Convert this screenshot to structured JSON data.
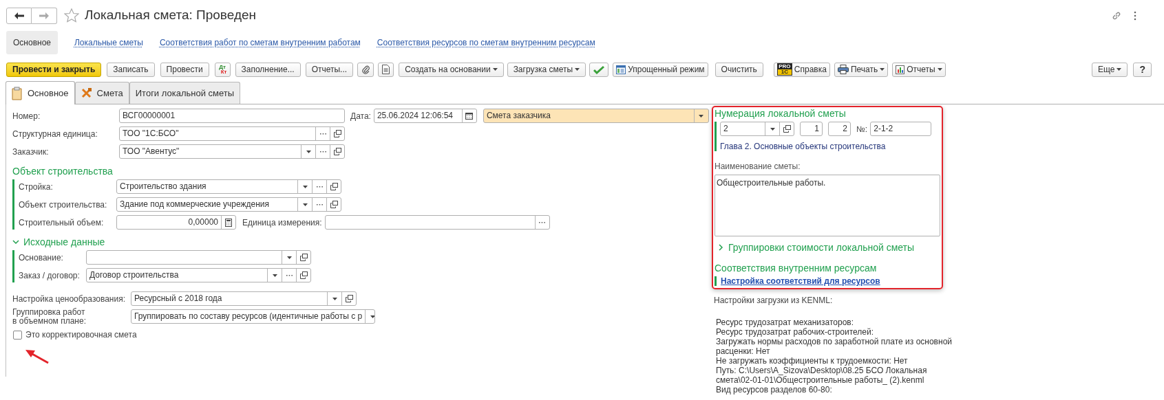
{
  "window": {
    "title": "Локальная смета: Проведен",
    "favorite": false
  },
  "nav": [
    {
      "label": "Основное",
      "selected": true
    },
    {
      "label": "Локальные сметы",
      "selected": false
    },
    {
      "label": "Соответствия работ по сметам внутренним работам",
      "selected": false
    },
    {
      "label": "Соответствия ресурсов по сметам внутренним ресурсам",
      "selected": false
    }
  ],
  "toolbar": {
    "left": [
      {
        "kind": "primary",
        "label": "Провести и закрыть"
      },
      {
        "kind": "button",
        "label": "Записать"
      },
      {
        "kind": "button",
        "label": "Провести"
      },
      {
        "kind": "ledger",
        "debit": "Дт",
        "credit": "Кт"
      },
      {
        "kind": "button",
        "label": "Заполнение..."
      },
      {
        "kind": "button",
        "label": "Отчеты..."
      },
      {
        "kind": "clip"
      },
      {
        "kind": "sheet"
      },
      {
        "kind": "dropdown",
        "label": "Создать на основании"
      },
      {
        "kind": "dropdown",
        "label": "Загрузка сметы"
      },
      {
        "kind": "tick"
      },
      {
        "kind": "table",
        "label": "Упрощенный режим"
      },
      {
        "kind": "button",
        "label": "Очистить"
      },
      {
        "kind": "help",
        "label": "Справка",
        "badge": [
          "PRO",
          "1C"
        ]
      },
      {
        "kind": "printer",
        "label": "Печать"
      },
      {
        "kind": "chart",
        "label": "Отчеты"
      }
    ],
    "right": [
      {
        "kind": "dropdown",
        "label": "Еще"
      },
      {
        "kind": "button",
        "label": "?"
      }
    ]
  },
  "form_tabs": [
    {
      "label": "Основное",
      "selected": true,
      "kind": "clipboard"
    },
    {
      "label": "Смета",
      "selected": false,
      "kind": "tools"
    },
    {
      "label": "Итоги локальной сметы",
      "selected": false,
      "kind": "plain"
    }
  ],
  "number": {
    "label": "Номер:",
    "value": "ВСГ00000001"
  },
  "date": {
    "label": "Дата:",
    "value": "25.06.2024 12:06:54"
  },
  "estimate_type": {
    "value": "Смета заказчика"
  },
  "fields": [
    {
      "label": "Структурная единица:",
      "value": "ТОО \"1С:БСО\"",
      "dropdown": false,
      "choose": true,
      "open": true
    },
    {
      "label": "Заказчик:",
      "value": "ТОО \"Авентус\"",
      "dropdown": true,
      "choose": true,
      "open": true
    }
  ],
  "construction": {
    "title": "Объект строительства",
    "fields": [
      {
        "label": "Стройка:",
        "value": "Строительство здания",
        "dropdown": true,
        "choose": true,
        "open": true
      },
      {
        "label": "Объект строительства:",
        "value": "Здание под коммерческие учреждения",
        "dropdown": true,
        "choose": true,
        "open": true
      }
    ],
    "volume": {
      "label": "Строительный объем:",
      "value": "0,00000"
    },
    "unit": {
      "label": "Единица измерения:"
    }
  },
  "source": {
    "title": "Исходные данные",
    "expanded": true,
    "fields": [
      {
        "label": "Основание:",
        "dropdown": true,
        "choose": false,
        "open": true
      },
      {
        "label": "Заказ / договор:",
        "value": "Договор строительства",
        "dropdown": true,
        "choose": true,
        "open": true
      }
    ]
  },
  "pricing": {
    "label": "Настройка ценообразования:",
    "value": "Ресурсный с 2018 года",
    "dropdown": true,
    "choose": false,
    "open": true
  },
  "grouping": {
    "label": "Группировка работ\nв объемном плане:",
    "value": "Группировать по составу ресурсов (идентичные работы с р",
    "dropdown": true,
    "choose": false,
    "open": false
  },
  "correction": {
    "label": "Это корректировочная смета",
    "checked": false
  },
  "numbering": {
    "title": "Нумерация локальной сметы",
    "chapter": "2",
    "part1": "1",
    "part2": "2",
    "no_label": "№:",
    "no_value": "2-1-2",
    "chapter_name": "Глава 2. Основные объекты строительства"
  },
  "estimate_name": {
    "label": "Наименование сметы:",
    "value": "Общестроительные работы."
  },
  "cost_groups": {
    "title": "Группировки стоимости локальной сметы",
    "expanded": false
  },
  "resource_match": {
    "title": "Соответствия внутренним ресурсам",
    "link": "Настройка соответствий для ресурсов"
  },
  "kenml": {
    "title": "Настройки загрузки из KENML:",
    "lines": [
      "Ресурс трудозатрат механизаторов:",
      "Ресурс трудозатрат рабочих-строителей:",
      "Загружать нормы расходов по заработной плате из основной",
      "расценки: Нет",
      "Не загружать коэффициенты к трудоемкости: Нет",
      "Путь: C:\\Users\\A_Sizova\\Desktop\\08.25 БСО Локальная",
      "смета\\02-01-01\\Общестроительные работы_ (2).kenml",
      "Вид ресурсов разделов 60-80:"
    ]
  }
}
